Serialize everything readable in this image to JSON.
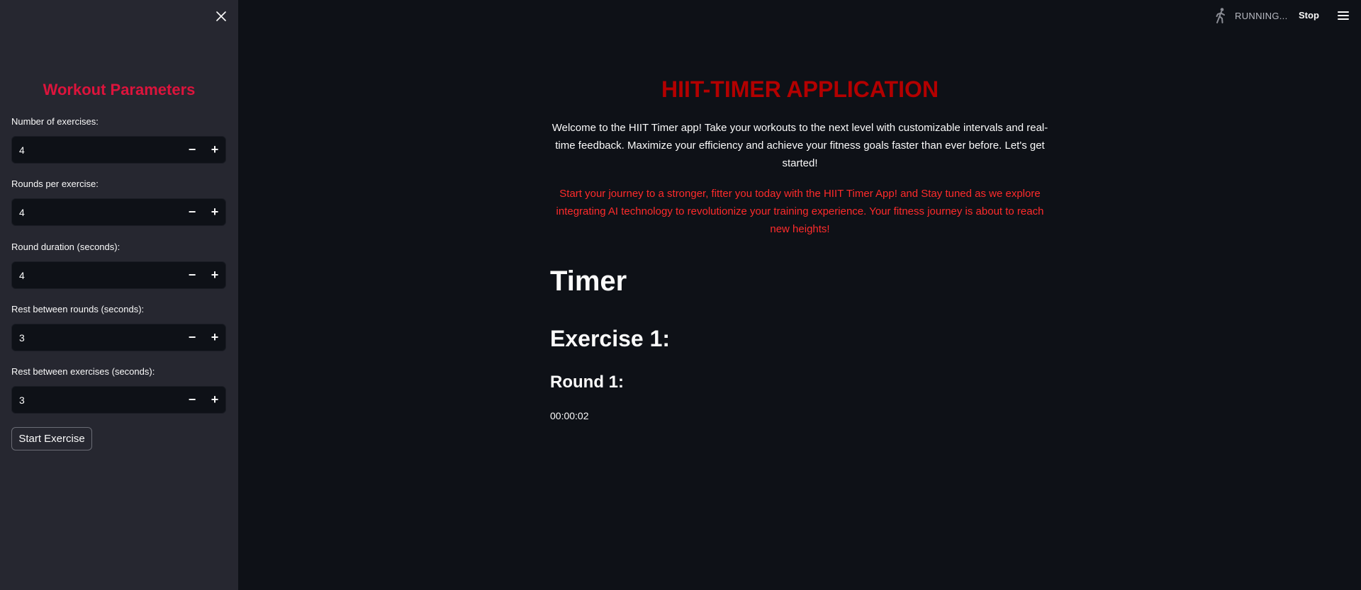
{
  "sidebar": {
    "title": "Workout Parameters",
    "fields": [
      {
        "label": "Number of exercises:",
        "value": "4"
      },
      {
        "label": "Rounds per exercise:",
        "value": "4"
      },
      {
        "label": "Round duration (seconds):",
        "value": "4"
      },
      {
        "label": "Rest between rounds (seconds):",
        "value": "3"
      },
      {
        "label": "Rest between exercises (seconds):",
        "value": "3"
      }
    ],
    "minus_symbol": "−",
    "plus_symbol": "+",
    "start_button": "Start Exercise"
  },
  "topbar": {
    "status": "RUNNING...",
    "stop": "Stop",
    "status_icon": "running-person-icon",
    "menu_icon": "hamburger-menu-icon"
  },
  "main": {
    "title": "HIIT-TIMER APPLICATION",
    "intro": "Welcome to the HIIT Timer app! Take your workouts to the next level with customizable intervals and real-time feedback. Maximize your efficiency and achieve your fitness goals faster than ever before. Let's get started!",
    "intro_highlight": "Start your journey to a stronger, fitter you today with the HIIT Timer App! and Stay tuned as we explore integrating AI technology to revolutionize your training experience. Your fitness journey is about to reach new heights!",
    "timer_heading": "Timer",
    "exercise_heading": "Exercise 1:",
    "round_heading": "Round 1:",
    "timer_value": "00:00:02"
  },
  "colors": {
    "background": "#0e1117",
    "sidebar": "#262730",
    "accent_title": "#dc143c",
    "app_title": "#b30000",
    "highlight_text": "#ff2b2b"
  }
}
